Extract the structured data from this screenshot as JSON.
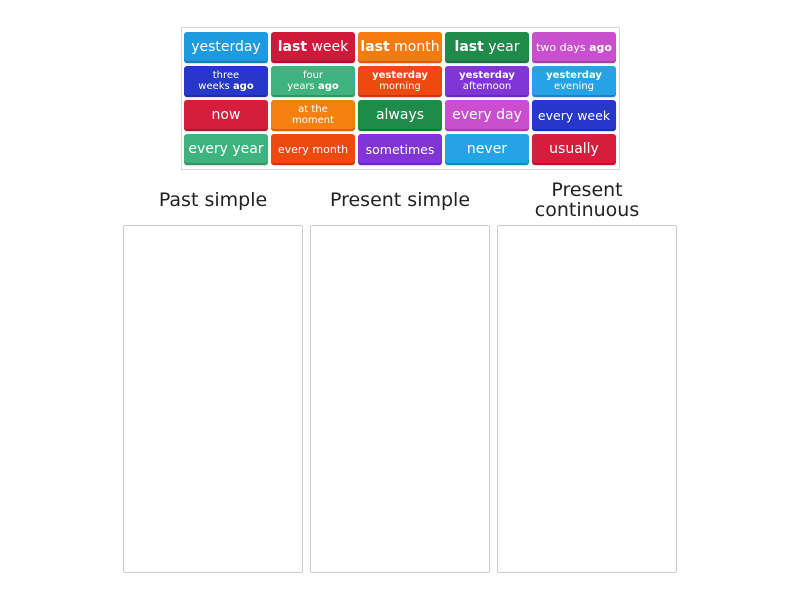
{
  "tiles": [
    {
      "parts": [
        {
          "t": "yesterday",
          "b": false
        }
      ],
      "color": "#1e9ae0",
      "row": 0,
      "col": 0,
      "size": "l"
    },
    {
      "parts": [
        {
          "t": "last",
          "b": true
        },
        {
          "t": " week",
          "b": false
        }
      ],
      "color": "#d0193a",
      "row": 0,
      "col": 1,
      "size": "l"
    },
    {
      "parts": [
        {
          "t": "last",
          "b": true
        },
        {
          "t": " month",
          "b": false
        }
      ],
      "color": "#f57b0f",
      "row": 0,
      "col": 2,
      "size": "l"
    },
    {
      "parts": [
        {
          "t": "last",
          "b": true
        },
        {
          "t": " year",
          "b": false
        }
      ],
      "color": "#1f8a4a",
      "row": 0,
      "col": 3,
      "size": "l"
    },
    {
      "parts": [
        {
          "t": "two days ",
          "b": false
        },
        {
          "t": "ago",
          "b": true
        }
      ],
      "color": "#c94fce",
      "row": 0,
      "col": 4,
      "size": "s"
    },
    {
      "parts": [
        {
          "t": "three",
          "b": false
        },
        {
          "t": "\n",
          "b": false
        },
        {
          "t": "weeks ",
          "b": false
        },
        {
          "t": "ago",
          "b": true
        }
      ],
      "color": "#2637c9",
      "row": 1,
      "col": 0,
      "size": "xs"
    },
    {
      "parts": [
        {
          "t": "four",
          "b": false
        },
        {
          "t": "\n",
          "b": false
        },
        {
          "t": "years ",
          "b": false
        },
        {
          "t": "ago",
          "b": true
        }
      ],
      "color": "#3fb37d",
      "row": 1,
      "col": 1,
      "size": "xs"
    },
    {
      "parts": [
        {
          "t": "yesterday",
          "b": true
        },
        {
          "t": "\n",
          "b": false
        },
        {
          "t": "morning",
          "b": false
        }
      ],
      "color": "#ec4a0f",
      "row": 1,
      "col": 2,
      "size": "xs"
    },
    {
      "parts": [
        {
          "t": "yesterday",
          "b": true
        },
        {
          "t": "\n",
          "b": false
        },
        {
          "t": "afternoon",
          "b": false
        }
      ],
      "color": "#8135d6",
      "row": 1,
      "col": 3,
      "size": "xs"
    },
    {
      "parts": [
        {
          "t": "yesterday",
          "b": true
        },
        {
          "t": "\n",
          "b": false
        },
        {
          "t": "evening",
          "b": false
        }
      ],
      "color": "#25a3e6",
      "row": 1,
      "col": 4,
      "size": "xs"
    },
    {
      "parts": [
        {
          "t": "now",
          "b": false
        }
      ],
      "color": "#d61d3c",
      "row": 2,
      "col": 0,
      "size": "l"
    },
    {
      "parts": [
        {
          "t": "at the",
          "b": false
        },
        {
          "t": "\n",
          "b": false
        },
        {
          "t": "moment",
          "b": false
        }
      ],
      "color": "#f5800f",
      "row": 2,
      "col": 1,
      "size": "xs"
    },
    {
      "parts": [
        {
          "t": "always",
          "b": false
        }
      ],
      "color": "#1f8a4a",
      "row": 2,
      "col": 2,
      "size": "l"
    },
    {
      "parts": [
        {
          "t": "every day",
          "b": false
        }
      ],
      "color": "#c94fce",
      "row": 2,
      "col": 3,
      "size": "l"
    },
    {
      "parts": [
        {
          "t": "every week",
          "b": false
        }
      ],
      "color": "#2637c9",
      "row": 2,
      "col": 4,
      "size": "m"
    },
    {
      "parts": [
        {
          "t": "every year",
          "b": false
        }
      ],
      "color": "#3fb37d",
      "row": 3,
      "col": 0,
      "size": "l"
    },
    {
      "parts": [
        {
          "t": "every month",
          "b": false
        }
      ],
      "color": "#ec4a0f",
      "row": 3,
      "col": 1,
      "size": "s"
    },
    {
      "parts": [
        {
          "t": "sometimes",
          "b": false
        }
      ],
      "color": "#8135d6",
      "row": 3,
      "col": 2,
      "size": "m"
    },
    {
      "parts": [
        {
          "t": "never",
          "b": false
        }
      ],
      "color": "#25a3e6",
      "row": 3,
      "col": 3,
      "size": "l"
    },
    {
      "parts": [
        {
          "t": "usually",
          "b": false
        }
      ],
      "color": "#d61d3c",
      "row": 3,
      "col": 4,
      "size": "l"
    }
  ],
  "columns": [
    {
      "id": "past-simple",
      "title": "Past simple"
    },
    {
      "id": "present-simple",
      "title": "Present simple"
    },
    {
      "id": "present-continuous",
      "title": "Present\ncontinuous"
    }
  ]
}
